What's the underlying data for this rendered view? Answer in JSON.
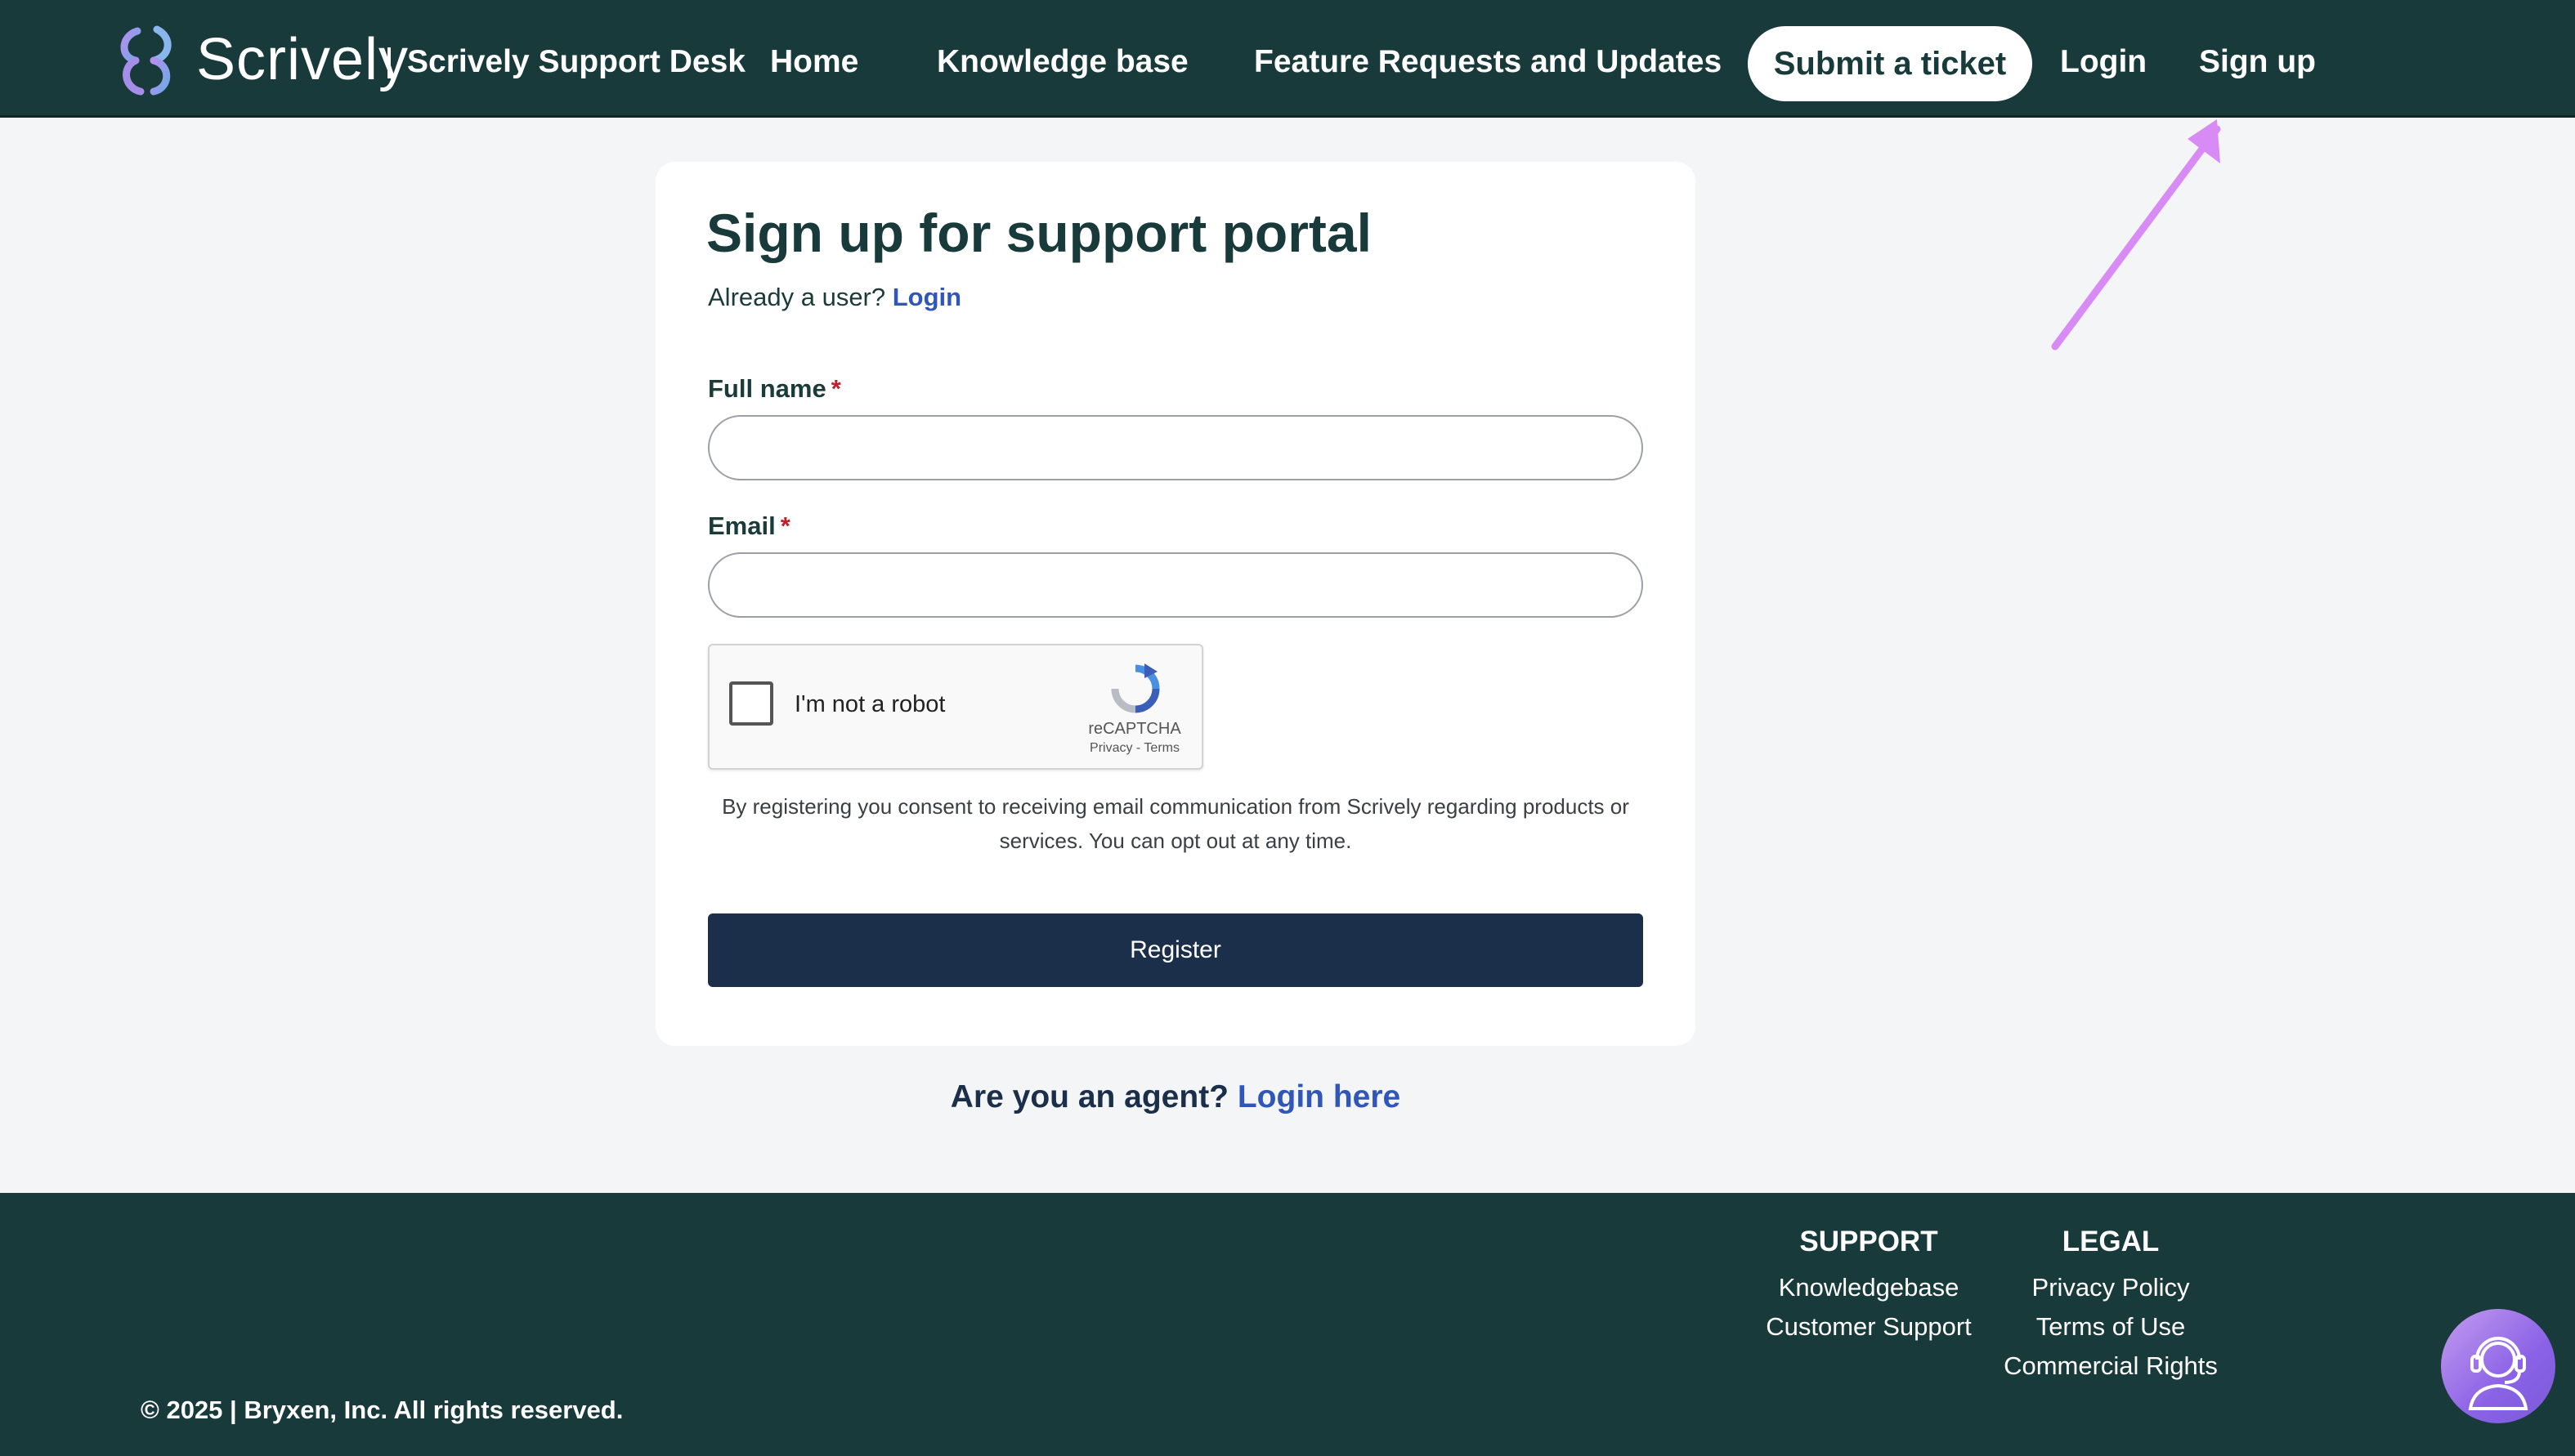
{
  "header": {
    "brand": "Scrively",
    "portal_name": "Scrively Support Desk",
    "nav": [
      "Home",
      "Knowledge base",
      "Feature Requests and Updates"
    ],
    "submit_ticket": "Submit a ticket",
    "login": "Login",
    "signup": "Sign up"
  },
  "form": {
    "title": "Sign up for support portal",
    "already_user": "Already a user?",
    "login_link": "Login",
    "full_name_label": "Full name",
    "email_label": "Email",
    "required_mark": "*",
    "full_name_value": "",
    "email_value": "",
    "captcha": {
      "label": "I'm not a robot",
      "brand": "reCAPTCHA",
      "links": "Privacy - Terms"
    },
    "consent": "By registering you consent to receiving email communication from Scrively regarding products or services. You can opt out at any time.",
    "register_label": "Register"
  },
  "agent": {
    "question": "Are you an agent?",
    "link": "Login here"
  },
  "footer": {
    "support_title": "SUPPORT",
    "support_links": [
      "Knowledgebase",
      "Customer Support"
    ],
    "legal_title": "LEGAL",
    "legal_links": [
      "Privacy Policy",
      "Terms of Use",
      "Commercial Rights"
    ],
    "copyright": "© 2025 | Bryxen, Inc. All rights reserved."
  },
  "colors": {
    "header_bg": "#183a3a",
    "page_bg": "#f4f5f7",
    "link": "#2f56b8",
    "register_bg": "#1c2f4a",
    "annotation_arrow": "#d98bf5"
  }
}
